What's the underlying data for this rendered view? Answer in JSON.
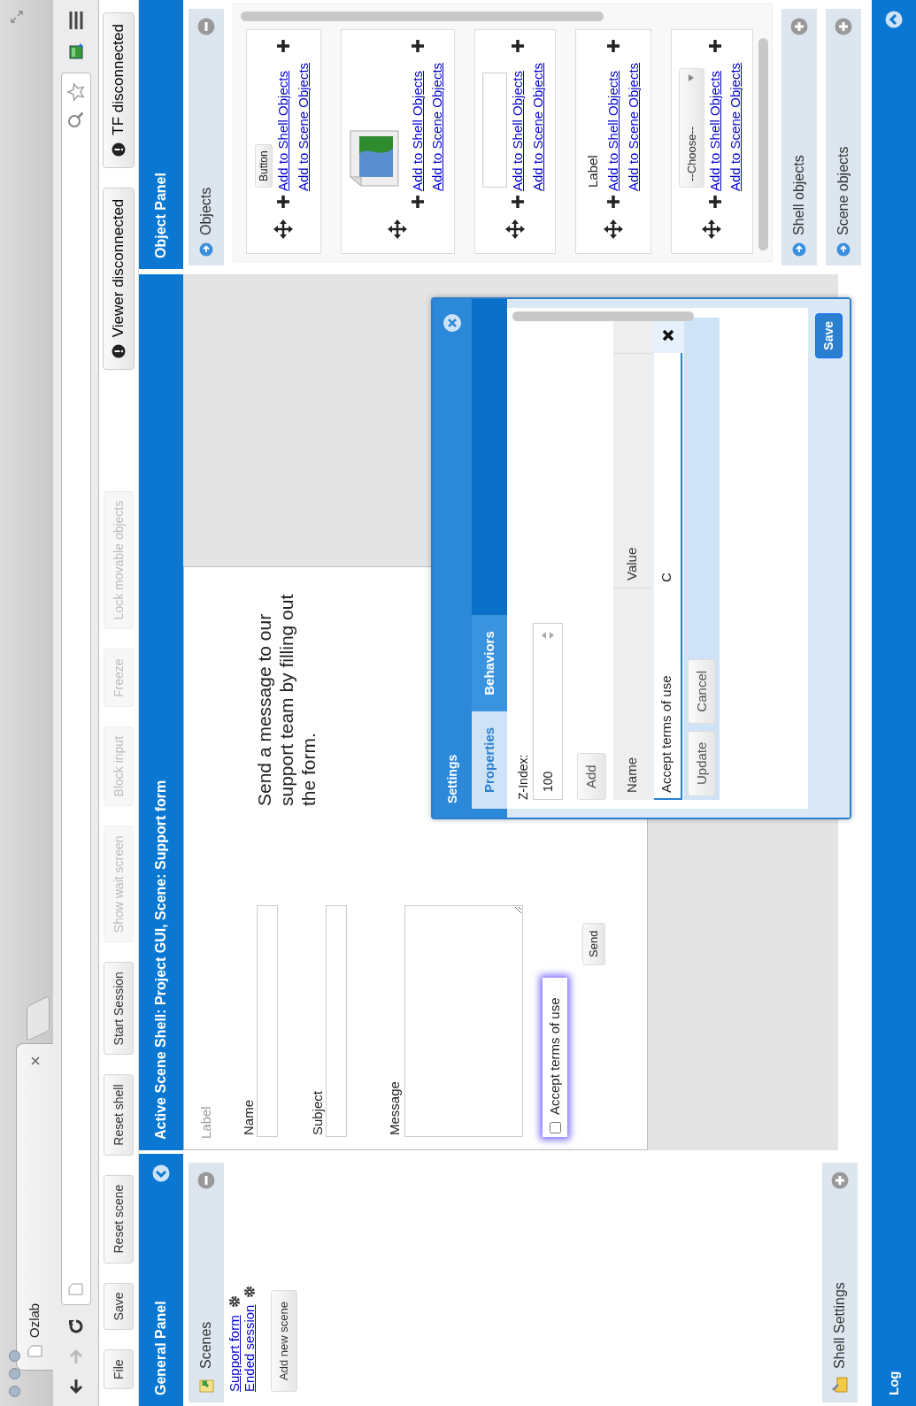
{
  "browser": {
    "tab_title": "Ozlab"
  },
  "toolbar": [
    {
      "label": "File",
      "disabled": false
    },
    {
      "label": "Save",
      "disabled": false
    },
    {
      "label": "Reset scene",
      "disabled": false
    },
    {
      "label": "Reset shell",
      "disabled": false
    },
    {
      "label": "Start Session",
      "disabled": false
    },
    {
      "label": "Show wait screen",
      "disabled": true
    },
    {
      "label": "Block input",
      "disabled": true
    },
    {
      "label": "Freeze",
      "disabled": true
    },
    {
      "label": "Lock movable objects",
      "disabled": true
    }
  ],
  "connection_status": [
    {
      "label": "Viewer disconnected"
    },
    {
      "label": "TF disconnected"
    }
  ],
  "general_panel": {
    "title": "General Panel",
    "scenes": {
      "title": "Scenes",
      "items": [
        {
          "label": "Support form"
        },
        {
          "label": "Ended session"
        }
      ],
      "add_button": "Add new scene"
    },
    "shell_settings": {
      "title": "Shell Settings"
    }
  },
  "workspace": {
    "title": "Active Scene Shell: Project GUI, Scene: Support form",
    "scene": {
      "caption": "Label",
      "fields": [
        {
          "label": "Name",
          "kind": "input"
        },
        {
          "label": "Subject",
          "kind": "input"
        },
        {
          "label": "Message",
          "kind": "textarea"
        }
      ],
      "checkbox": {
        "label": "Accept terms of use",
        "checked": false
      },
      "send_button": "Send",
      "text": "Send a message to our support team by filling out the form."
    }
  },
  "settings_dialog": {
    "title": "Settings",
    "tabs": [
      {
        "label": "Properties",
        "selected": true
      },
      {
        "label": "Behaviors",
        "selected": false
      }
    ],
    "z_index_label": "Z-Index:",
    "z_index_value": "100",
    "add_button": "Add",
    "table": {
      "columns": [
        "Name",
        "Value"
      ],
      "rows": [
        {
          "name": "Accept terms of use",
          "value": "C"
        }
      ]
    },
    "row_buttons": [
      "Update",
      "Cancel"
    ],
    "save_button": "Save"
  },
  "object_panel": {
    "title": "Object Panel",
    "objects": {
      "title": "Objects",
      "items": [
        {
          "kind": "button",
          "preview": "Button",
          "links": [
            "Add to Shell Objects",
            "Add to Scene Objects"
          ]
        },
        {
          "kind": "image",
          "links": [
            "Add to Shell Objects",
            "Add to Scene Objects"
          ]
        },
        {
          "kind": "textbox",
          "links": [
            "Add to Shell Objects",
            "Add to Scene Objects"
          ]
        },
        {
          "kind": "label",
          "preview": "Label",
          "links": [
            "Add to Shell Objects",
            "Add to Scene Objects"
          ]
        },
        {
          "kind": "select",
          "preview": "--Choose--",
          "links": [
            "Add to Shell Objects",
            "Add to Scene Objects"
          ]
        }
      ]
    },
    "sections": [
      {
        "title": "Shell objects"
      },
      {
        "title": "Scene objects"
      }
    ]
  },
  "log": {
    "title": "Log"
  }
}
